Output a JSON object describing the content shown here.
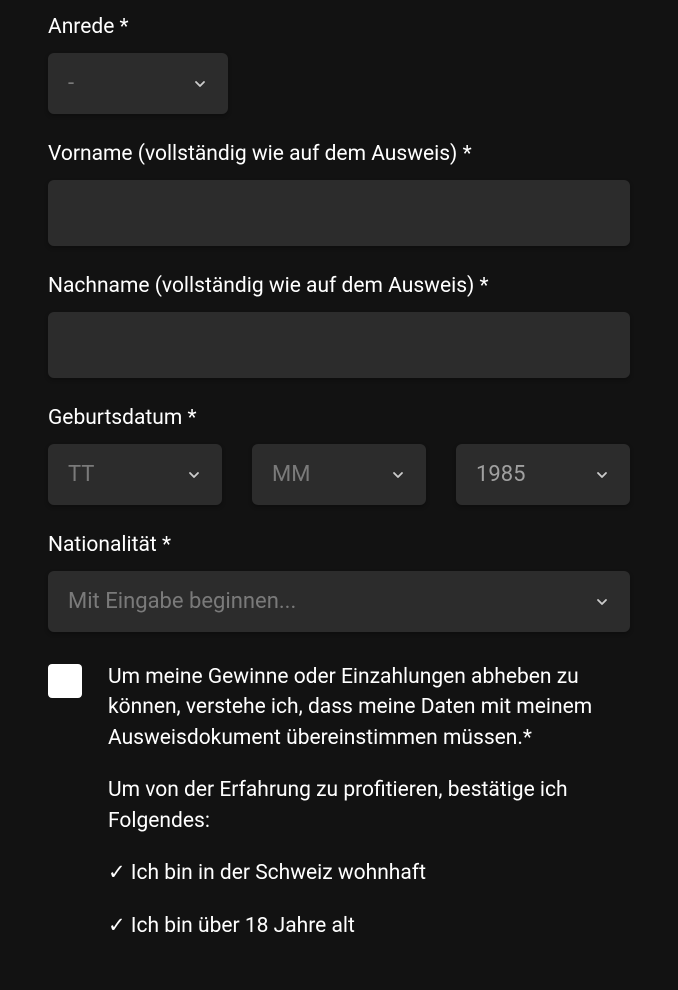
{
  "salutation": {
    "label": "Anrede *",
    "value": "-"
  },
  "firstname": {
    "label": "Vorname (vollständig wie auf dem Ausweis) *",
    "value": ""
  },
  "lastname": {
    "label": "Nachname (vollständig wie auf dem Ausweis) *",
    "value": ""
  },
  "birthdate": {
    "label": "Geburtsdatum *",
    "day": "TT",
    "month": "MM",
    "year": "1985"
  },
  "nationality": {
    "label": "Nationalität *",
    "placeholder": "Mit Eingabe beginnen..."
  },
  "consent": {
    "checkbox_text": "Um meine Gewinne oder Einzahlungen abheben zu können, verstehe ich, dass meine Daten mit meinem Ausweisdokument übereinstimmen müssen.*",
    "confirm_intro": "Um von der Erfahrung zu profitieren, bestätige ich Folgendes:",
    "confirm_items": [
      "✓ Ich bin in der Schweiz wohnhaft",
      "✓ Ich bin über 18 Jahre alt"
    ]
  }
}
